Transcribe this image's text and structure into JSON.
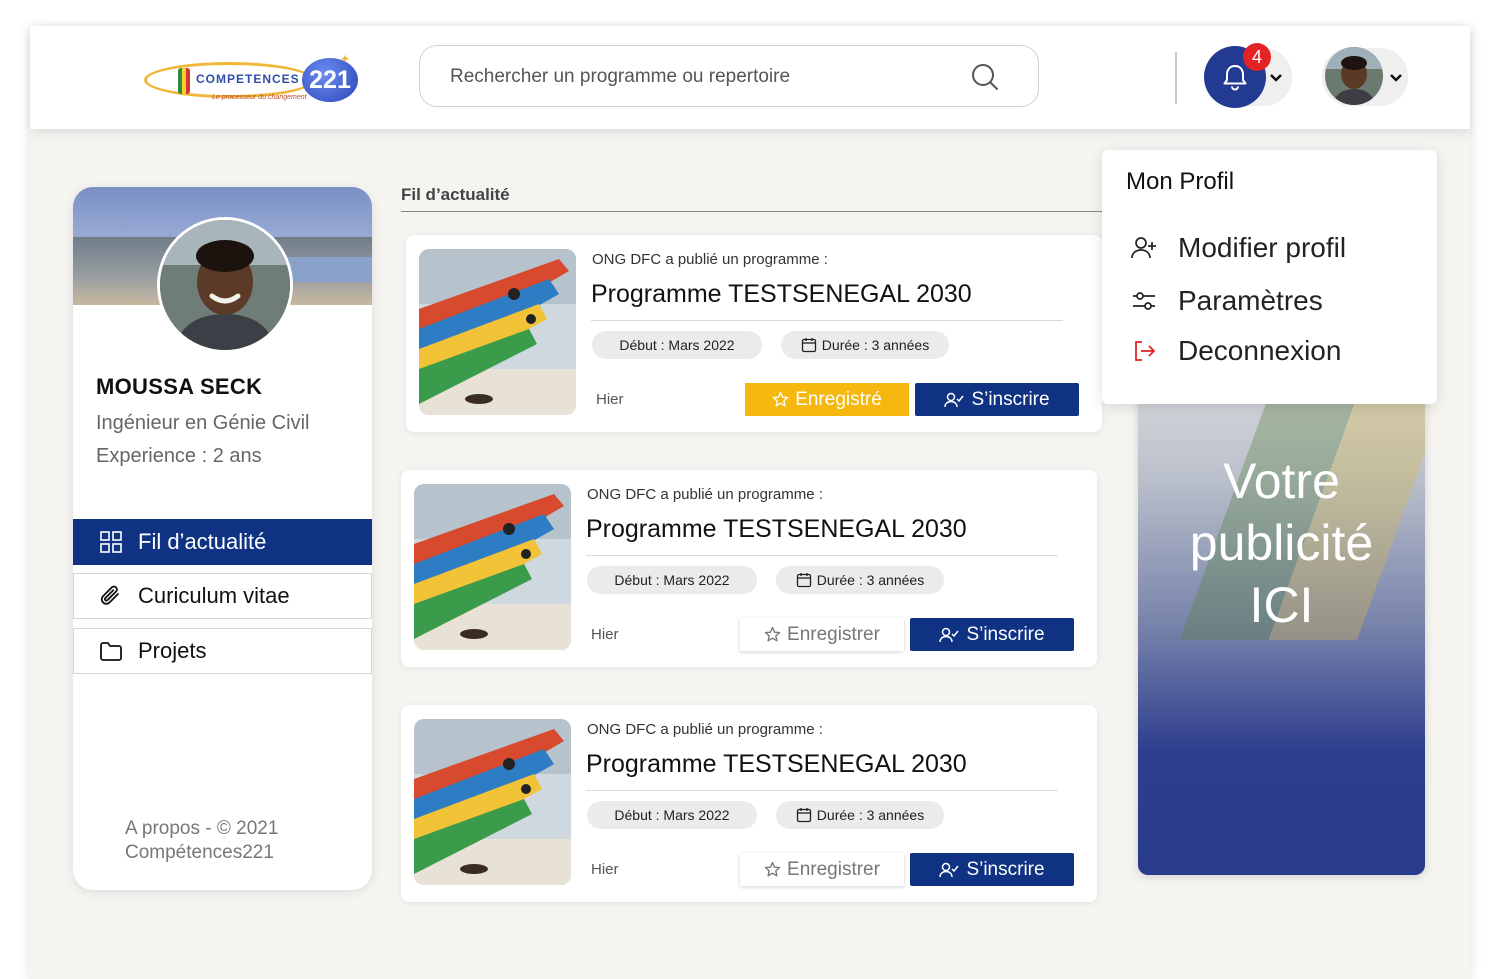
{
  "header": {
    "logo": {
      "word": "COMPETENCES",
      "num": "221",
      "tagline": "Le processeur du changement"
    },
    "search": {
      "placeholder": "Rechercher un programme ou repertoire"
    },
    "notifications": {
      "count": "4"
    }
  },
  "profile": {
    "name": "MOUSSA SECK",
    "title": "Ingénieur en Génie Civil",
    "experience": "Experience : 2 ans"
  },
  "sidebar": {
    "items": [
      {
        "label": "Fil d’actualité",
        "icon": "grid-icon",
        "active": true
      },
      {
        "label": "Curiculum vitae",
        "icon": "paperclip-icon",
        "active": false
      },
      {
        "label": "Projets",
        "icon": "folder-icon",
        "active": false
      }
    ],
    "footer_line1": "A propos - © 2021",
    "footer_line2": "Compétences221"
  },
  "feed": {
    "title": "Fil d’actualité",
    "posts": [
      {
        "meta": "ONG DFC a publié un programme :",
        "title": "Programme TESTSENEGAL 2030",
        "start": "Début : Mars 2022",
        "duration": "Durée : 3 années",
        "when": "Hier",
        "save_label": "Enregistré",
        "saved": true,
        "register_label": "S’inscrire"
      },
      {
        "meta": "ONG DFC a publié un programme :",
        "title": "Programme TESTSENEGAL 2030",
        "start": "Début : Mars 2022",
        "duration": "Durée : 3 années",
        "when": "Hier",
        "save_label": "Enregistrer",
        "saved": false,
        "register_label": "S’inscrire"
      },
      {
        "meta": "ONG DFC a publié un programme :",
        "title": "Programme TESTSENEGAL 2030",
        "start": "Début : Mars 2022",
        "duration": "Durée : 3 années",
        "when": "Hier",
        "save_label": "Enregistrer",
        "saved": false,
        "register_label": "S’inscrire"
      }
    ]
  },
  "ad": {
    "line1": "Votre",
    "line2": "publicité",
    "line3": "ICI"
  },
  "profile_menu": {
    "heading": "Mon Profil",
    "items": [
      {
        "label": "Modifier profil",
        "icon": "user-plus-icon"
      },
      {
        "label": "Paramètres",
        "icon": "sliders-icon"
      },
      {
        "label": "Deconnexion",
        "icon": "logout-icon"
      }
    ]
  },
  "colors": {
    "primary": "#0f3382",
    "accent": "#f6b70f",
    "badge": "#e42424",
    "logout": "#e42424"
  }
}
